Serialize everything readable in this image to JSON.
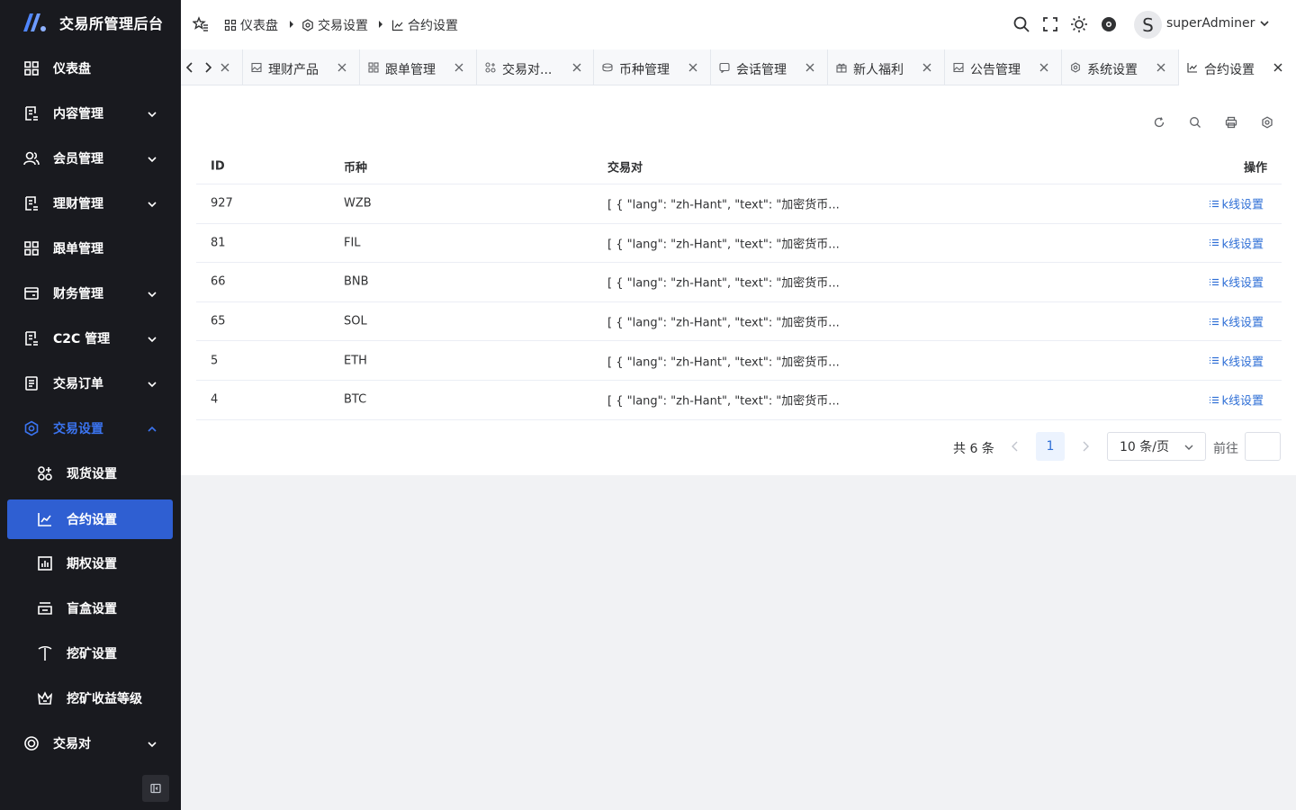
{
  "app": {
    "title": "交易所管理后台"
  },
  "sidebar": {
    "items": [
      {
        "label": "仪表盘",
        "icon": "dashboard-icon",
        "arrow": ""
      },
      {
        "label": "内容管理",
        "icon": "document-icon",
        "arrow": "down"
      },
      {
        "label": "会员管理",
        "icon": "users-icon",
        "arrow": "down"
      },
      {
        "label": "理财管理",
        "icon": "document-icon",
        "arrow": "down"
      },
      {
        "label": "跟单管理",
        "icon": "dashboard-icon",
        "arrow": ""
      },
      {
        "label": "财务管理",
        "icon": "wallet-icon",
        "arrow": "down"
      },
      {
        "label": "C2C 管理",
        "icon": "document-icon",
        "arrow": "down"
      },
      {
        "label": "交易订单",
        "icon": "order-icon",
        "arrow": "down"
      },
      {
        "label": "交易设置",
        "icon": "gear-icon",
        "arrow": "up"
      },
      {
        "label": "现货设置",
        "icon": "apps-icon",
        "arrow": ""
      },
      {
        "label": "合约设置",
        "icon": "line-chart-icon",
        "arrow": ""
      },
      {
        "label": "期权设置",
        "icon": "bar-chart-icon",
        "arrow": ""
      },
      {
        "label": "盲盒设置",
        "icon": "box-icon",
        "arrow": ""
      },
      {
        "label": "挖矿设置",
        "icon": "pickaxe-icon",
        "arrow": ""
      },
      {
        "label": "挖矿收益等级",
        "icon": "crown-icon",
        "arrow": ""
      },
      {
        "label": "交易对",
        "icon": "coin-icon",
        "arrow": "down"
      }
    ]
  },
  "header": {
    "breadcrumbs": [
      {
        "label": "仪表盘"
      },
      {
        "label": "交易设置"
      },
      {
        "label": "合约设置"
      }
    ],
    "user": {
      "avatar_letter": "S",
      "name": "superAdminer"
    }
  },
  "tabs": [
    {
      "label": "理财产品"
    },
    {
      "label": "跟单管理"
    },
    {
      "label": "交易对..."
    },
    {
      "label": "币种管理"
    },
    {
      "label": "会话管理"
    },
    {
      "label": "新人福利"
    },
    {
      "label": "公告管理"
    },
    {
      "label": "系统设置"
    },
    {
      "label": "合约设置"
    }
  ],
  "table": {
    "columns": [
      "ID",
      "币种",
      "交易对",
      "操作"
    ],
    "action_label": "k线设置",
    "rows": [
      {
        "id": "927",
        "coin": "WZB",
        "pair": "[ { \"lang\": \"zh-Hant\", \"text\": \"加密货币..."
      },
      {
        "id": "81",
        "coin": "FIL",
        "pair": "[ { \"lang\": \"zh-Hant\", \"text\": \"加密货币..."
      },
      {
        "id": "66",
        "coin": "BNB",
        "pair": "[ { \"lang\": \"zh-Hant\", \"text\": \"加密货币..."
      },
      {
        "id": "65",
        "coin": "SOL",
        "pair": "[ { \"lang\": \"zh-Hant\", \"text\": \"加密货币..."
      },
      {
        "id": "5",
        "coin": "ETH",
        "pair": "[ { \"lang\": \"zh-Hant\", \"text\": \"加密货币..."
      },
      {
        "id": "4",
        "coin": "BTC",
        "pair": "[ { \"lang\": \"zh-Hant\", \"text\": \"加密货币..."
      }
    ]
  },
  "pagination": {
    "total": "共 6 条",
    "current": "1",
    "page_size": "10 条/页",
    "goto": "前往",
    "goto_value": ""
  },
  "colors": {
    "sidebar_bg": "#191a1f",
    "accent": "#2f5fd2",
    "link": "#2f6fd6"
  }
}
